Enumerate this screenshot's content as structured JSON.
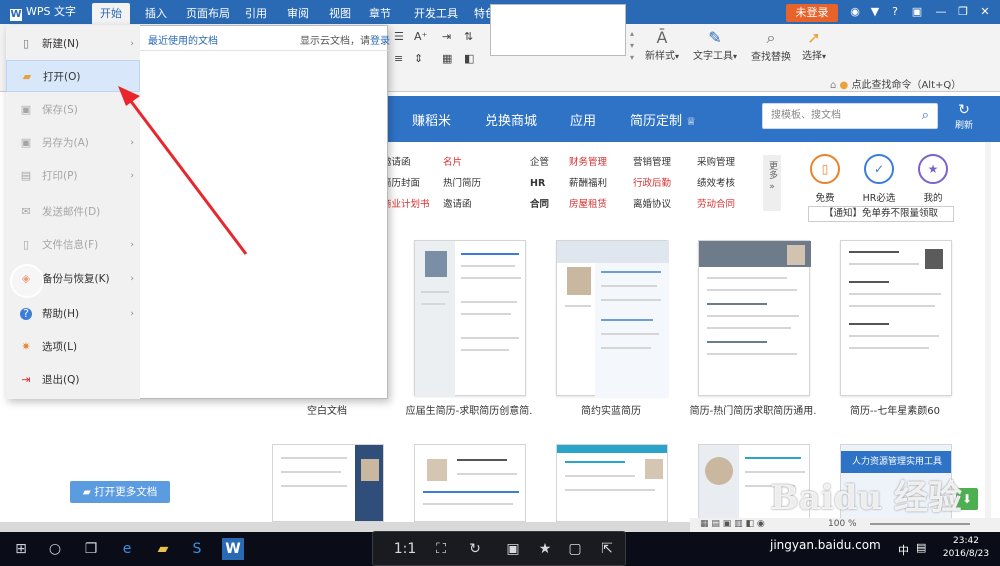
{
  "titlebar": {
    "app_label": "WPS 文字",
    "tabs": [
      "开始",
      "插入",
      "页面布局",
      "引用",
      "审阅",
      "视图",
      "章节",
      "开发工具",
      "特色功能"
    ],
    "login_label": "未登录"
  },
  "ribbon": {
    "new_style": "新样式",
    "text_tools": "文字工具",
    "find_replace": "查找替换",
    "select": "选择",
    "command_search": "点此查找命令（Alt+Q）"
  },
  "file_menu": {
    "items": [
      {
        "label": "新建(N)",
        "icon": "new-doc-icon",
        "arrow": true,
        "enabled": true
      },
      {
        "label": "打开(O)",
        "icon": "folder-open-icon",
        "arrow": false,
        "enabled": true,
        "selected": true
      },
      {
        "label": "保存(S)",
        "icon": "save-icon",
        "arrow": false,
        "enabled": false
      },
      {
        "label": "另存为(A)",
        "icon": "save-as-icon",
        "arrow": true,
        "enabled": false
      },
      {
        "label": "打印(P)",
        "icon": "print-icon",
        "arrow": true,
        "enabled": false
      },
      {
        "label": "发送邮件(D)",
        "icon": "mail-icon",
        "arrow": false,
        "enabled": false
      },
      {
        "label": "文件信息(F)",
        "icon": "file-info-icon",
        "arrow": true,
        "enabled": false
      },
      {
        "label": "备份与恢复(K)",
        "icon": "backup-icon",
        "arrow": true,
        "enabled": true
      },
      {
        "label": "帮助(H)",
        "icon": "help-icon",
        "arrow": true,
        "enabled": true
      },
      {
        "label": "选项(L)",
        "icon": "gear-icon",
        "arrow": false,
        "enabled": true
      },
      {
        "label": "退出(Q)",
        "icon": "exit-icon",
        "arrow": false,
        "enabled": true
      }
    ],
    "recent_title": "最近使用的文档",
    "cloud_text": "显示云文档，请",
    "cloud_login": "登录",
    "open_more": "打开更多文档"
  },
  "banner": {
    "nav": [
      "赚稻米",
      "兑换商城",
      "应用",
      "简历定制"
    ],
    "search_placeholder": "搜模板、搜文档",
    "refresh_label": "刷新"
  },
  "categories": [
    {
      "label": "邀请函",
      "color": "blk"
    },
    {
      "label": "名片",
      "color": "red"
    },
    {
      "label": "企管",
      "color": "blk"
    },
    {
      "label": "财务管理",
      "color": "red"
    },
    {
      "label": "营销管理",
      "color": "blk"
    },
    {
      "label": "采购管理",
      "color": "blk"
    },
    {
      "label": "简历封面",
      "color": "blk"
    },
    {
      "label": "热门简历",
      "color": "blk"
    },
    {
      "label": "HR",
      "color": "blk"
    },
    {
      "label": "薪酬福利",
      "color": "blk"
    },
    {
      "label": "行政后勤",
      "color": "red"
    },
    {
      "label": "绩效考核",
      "color": "blk"
    },
    {
      "label": "商业计划书",
      "color": "red"
    },
    {
      "label": "邀请函",
      "color": "blk"
    },
    {
      "label": "合同",
      "color": "blk"
    },
    {
      "label": "房屋租赁",
      "color": "red"
    },
    {
      "label": "离婚协议",
      "color": "blk"
    },
    {
      "label": "劳动合同",
      "color": "red"
    }
  ],
  "more_label": "更多",
  "services": [
    {
      "label": "免费",
      "icon": "free-icon",
      "color": "#e8832c"
    },
    {
      "label": "HR必选",
      "icon": "hr-check-icon",
      "color": "#3b7dd8"
    },
    {
      "label": "我的",
      "icon": "star-icon",
      "color": "#7a63c9"
    }
  ],
  "notice": "【通知】免单券不限量领取",
  "templates": [
    {
      "title": "空白文档"
    },
    {
      "title": "应届生简历-求职简历创意简."
    },
    {
      "title": "简约实蓝简历"
    },
    {
      "title": "简历-热门简历求职简历通用."
    },
    {
      "title": "简历--七年星素颜60"
    }
  ],
  "promo_banner": "人力资源管理实用工具",
  "statusbar": {
    "zoom": "100 %"
  },
  "watermark": "Baidu 经验",
  "watermark_url": "jingyan.baidu.com",
  "taskbar": {
    "viewer_ratio": "1:1",
    "ime": "中",
    "time": "23:42",
    "date": "2016/8/23"
  }
}
